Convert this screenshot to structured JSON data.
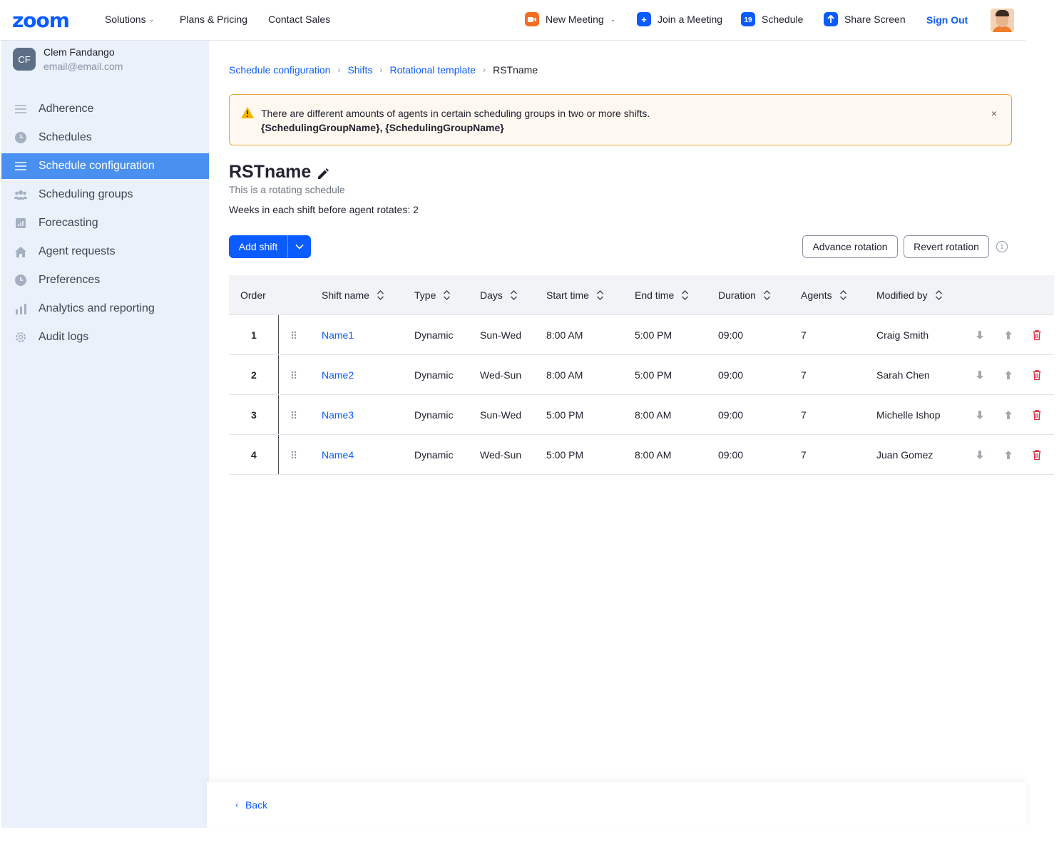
{
  "topnav": {
    "logo": "zoom",
    "links": [
      {
        "label": "Solutions",
        "has_chevron": true
      },
      {
        "label": "Plans & Pricing"
      },
      {
        "label": "Contact Sales"
      }
    ],
    "actions": [
      {
        "label": "New Meeting",
        "icon": "video-camera-icon",
        "color": "#f26d21",
        "has_chevron": true
      },
      {
        "label": "Join a Meeting",
        "icon": "plus-icon",
        "color": "#0b5cff"
      },
      {
        "label": "Schedule",
        "icon": "calendar-icon",
        "color": "#0b5cff",
        "calendar_day": "19"
      },
      {
        "label": "Share Screen",
        "icon": "arrow-up-icon",
        "color": "#0b5cff"
      }
    ],
    "sign_out": "Sign Out"
  },
  "user": {
    "initials": "CF",
    "name": "Clem Fandango",
    "email": "email@email.com"
  },
  "sidebar": {
    "items": [
      {
        "label": "Adherence",
        "icon": "list-icon",
        "active": false
      },
      {
        "label": "Schedules",
        "icon": "clock-icon",
        "active": false
      },
      {
        "label": "Schedule configuration",
        "icon": "list-icon",
        "active": true
      },
      {
        "label": "Scheduling groups",
        "icon": "people-icon",
        "active": false
      },
      {
        "label": "Forecasting",
        "icon": "forecast-chart-icon",
        "active": false
      },
      {
        "label": "Agent requests",
        "icon": "home-icon",
        "active": false
      },
      {
        "label": "Preferences",
        "icon": "clock-icon",
        "active": false
      },
      {
        "label": "Analytics and reporting",
        "icon": "bar-chart-icon",
        "active": false
      },
      {
        "label": "Audit logs",
        "icon": "gear-icon",
        "active": false
      }
    ]
  },
  "breadcrumb": {
    "items": [
      "Schedule configuration",
      "Shifts",
      "Rotational template"
    ],
    "current": "RSTname"
  },
  "alert": {
    "message": "There are different amounts of agents in certain scheduling groups in two or more shifts.",
    "groups": "{SchedulingGroupName}, {SchedulingGroupName}",
    "close": "×"
  },
  "page": {
    "title": "RSTname",
    "subtitle": "This is a rotating schedule",
    "weeks_text": "Weeks in each shift before agent rotates: 2"
  },
  "toolbar": {
    "add_shift": "Add shift",
    "advance_rotation": "Advance rotation",
    "revert_rotation": "Revert rotation",
    "info": "i"
  },
  "table": {
    "headers": {
      "order": "Order",
      "shift_name": "Shift name",
      "type": "Type",
      "days": "Days",
      "start_time": "Start time",
      "end_time": "End time",
      "duration": "Duration",
      "agents": "Agents",
      "modified_by": "Modified by"
    },
    "rows": [
      {
        "order": "1",
        "name": "Name1",
        "type": "Dynamic",
        "days": "Sun-Wed",
        "start": "8:00 AM",
        "end": "5:00 PM",
        "duration": "09:00",
        "agents": "7",
        "modified_by": "Craig Smith"
      },
      {
        "order": "2",
        "name": "Name2",
        "type": "Dynamic",
        "days": "Wed-Sun",
        "start": "8:00 AM",
        "end": "5:00 PM",
        "duration": "09:00",
        "agents": "7",
        "modified_by": "Sarah Chen"
      },
      {
        "order": "3",
        "name": "Name3",
        "type": "Dynamic",
        "days": "Sun-Wed",
        "start": "5:00 PM",
        "end": "8:00 AM",
        "duration": "09:00",
        "agents": "7",
        "modified_by": "Michelle Ishop"
      },
      {
        "order": "4",
        "name": "Name4",
        "type": "Dynamic",
        "days": "Wed-Sun",
        "start": "5:00 PM",
        "end": "8:00 AM",
        "duration": "09:00",
        "agents": "7",
        "modified_by": "Juan Gomez"
      }
    ]
  },
  "footer": {
    "back": "Back"
  },
  "colors": {
    "brand": "#0b5cff",
    "active_nav": "#4a90f0",
    "sidebar_bg": "#eaf1fa",
    "alert_border": "#e3a53a",
    "delete": "#d92b3a"
  }
}
